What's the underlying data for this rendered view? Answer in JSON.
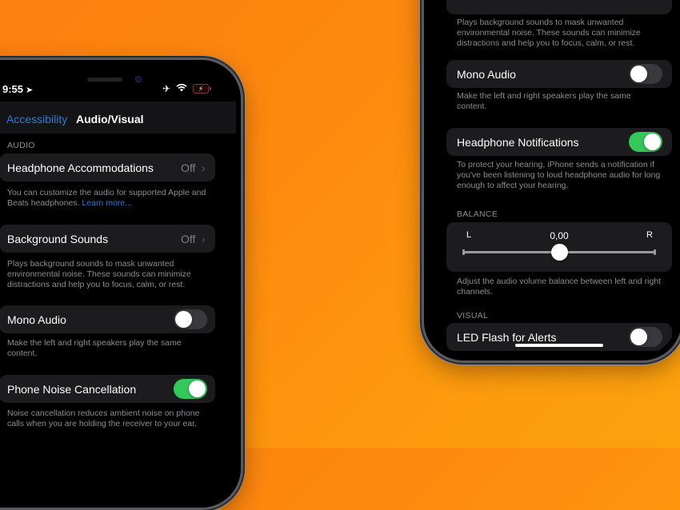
{
  "left_phone": {
    "status_bar": {
      "time": "9:55",
      "location_icon": "location-arrow-icon",
      "airplane_icon": "airplane-icon",
      "wifi_icon": "wifi-icon",
      "battery_icon": "battery-charging-icon",
      "battery_color": "#8a3434"
    },
    "nav": {
      "back_label": "Accessibility",
      "title": "Audio/Visual"
    },
    "section_audio": "AUDIO",
    "rows": [
      {
        "label": "Headphone Accommodations",
        "value": "Off",
        "type": "disclosure",
        "footer": "You can customize the audio for supported Apple and Beats headphones.",
        "footer_link": "Learn more..."
      },
      {
        "label": "Background Sounds",
        "value": "Off",
        "type": "disclosure",
        "footer": "Plays background sounds to mask unwanted environmental noise. These sounds can minimize distractions and help you to focus, calm, or rest."
      },
      {
        "label": "Mono Audio",
        "type": "toggle",
        "on": false,
        "footer": "Make the left and right speakers play the same content."
      },
      {
        "label": "Phone Noise Cancellation",
        "type": "toggle",
        "on": true,
        "footer": "Noise cancellation reduces ambient noise on phone calls when you are holding the receiver to your ear."
      }
    ]
  },
  "right_phone": {
    "top_footer": "Plays background sounds to mask unwanted environmental noise. These sounds can minimize distractions and help you to focus, calm, or rest.",
    "rows": [
      {
        "label": "Mono Audio",
        "type": "toggle",
        "on": false,
        "footer": "Make the left and right speakers play the same content."
      },
      {
        "label": "Headphone Notifications",
        "type": "toggle",
        "on": true,
        "footer": "To protect your hearing, iPhone sends a notification if you've been listening to loud headphone audio for long enough to affect your hearing."
      }
    ],
    "balance": {
      "section": "BALANCE",
      "left_label": "L",
      "right_label": "R",
      "value_text": "0,00",
      "value": 0.0,
      "range": [
        -1,
        1
      ],
      "footer": "Adjust the audio volume balance between left and right channels."
    },
    "section_visual": "VISUAL",
    "visual_rows": [
      {
        "label": "LED Flash for Alerts",
        "type": "toggle",
        "on": false
      }
    ]
  },
  "colors": {
    "background_orange": "#fd8a0e",
    "ios_blue": "#2f7bd9",
    "toggle_green": "#34c759",
    "cell_bg": "#1c1c1e"
  }
}
